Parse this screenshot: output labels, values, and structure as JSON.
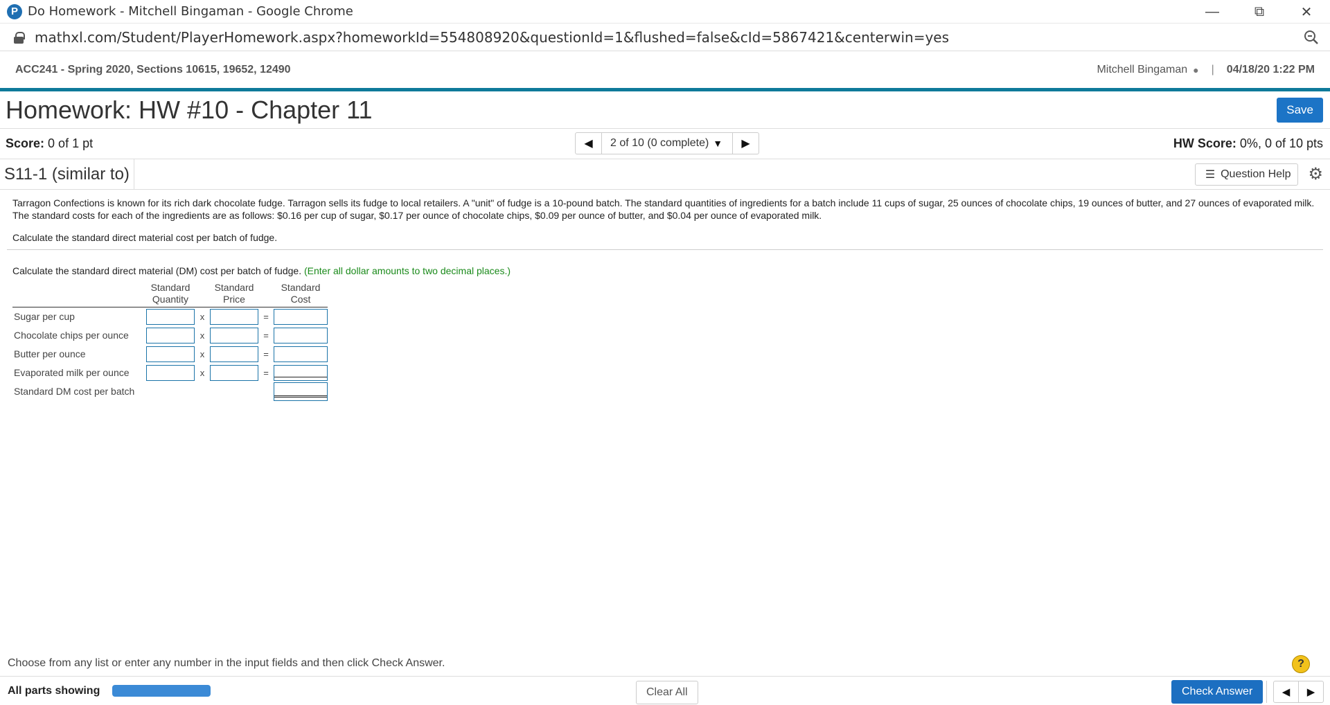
{
  "browser": {
    "window_title": "Do Homework - Mitchell Bingaman - Google Chrome",
    "favicon_letter": "P",
    "url": "mathxl.com/Student/PlayerHomework.aspx?homeworkId=554808920&questionId=1&flushed=false&cId=5867421&centerwin=yes"
  },
  "header": {
    "course": "ACC241 - Spring 2020, Sections 10615, 19652, 12490",
    "user": "Mitchell Bingaman",
    "separator": "|",
    "datetime": "04/18/20 1:22 PM"
  },
  "homework": {
    "title": "Homework: HW #10 - Chapter 11",
    "save_label": "Save",
    "score_label": "Score:",
    "score_value": "0 of 1 pt",
    "nav_text": "2 of 10 (0 complete)",
    "hw_score_label": "HW Score:",
    "hw_score_value": "0%, 0 of 10 pts"
  },
  "question": {
    "id": "S11-1 (similar to)",
    "help_label": "Question Help",
    "text": "Tarragon Confections is known for its rich dark chocolate fudge. Tarragon sells its fudge to local retailers. A \"unit\" of fudge is a 10-pound batch. The standard quantities of ingredients for a batch include 11 cups of sugar, 25 ounces of chocolate chips, 19 ounces of butter, and 27 ounces of evaporated milk. The standard costs for each of the ingredients are as follows: $0.16 per cup of sugar, $0.17 per ounce of chocolate chips, $0.09 per ounce of butter, and $0.04 per ounce of evaporated milk.",
    "prompt": "Calculate the standard direct material cost per batch of fudge.",
    "instruction": "Calculate the standard direct material (DM) cost per batch of fudge.",
    "instruction_note": "(Enter all dollar amounts to two decimal places.)"
  },
  "table": {
    "headers": {
      "qty_line1": "Standard",
      "qty_line2": "Quantity",
      "price_line1": "Standard",
      "price_line2": "Price",
      "cost_line1": "Standard",
      "cost_line2": "Cost"
    },
    "times": "x",
    "equals": "=",
    "rows": [
      {
        "label": "Sugar per cup"
      },
      {
        "label": "Chocolate chips per ounce"
      },
      {
        "label": "Butter per ounce"
      },
      {
        "label": "Evaporated milk per ounce"
      }
    ],
    "total_label": "Standard DM cost per batch"
  },
  "footer": {
    "hint": "Choose from any list or enter any number in the input fields and then click Check Answer.",
    "help_glyph": "?",
    "all_parts": "All parts showing",
    "clear_all": "Clear All",
    "check_answer": "Check Answer"
  }
}
